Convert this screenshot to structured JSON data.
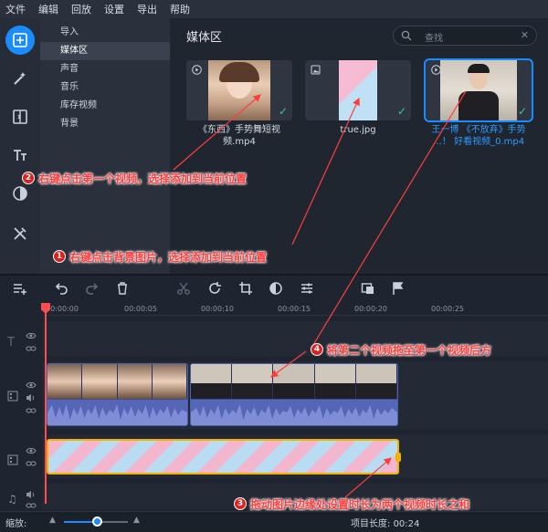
{
  "menu": [
    "文件",
    "编辑",
    "回放",
    "设置",
    "导出",
    "帮助"
  ],
  "nav": {
    "items": [
      "导入",
      "媒体区",
      "声音",
      "音乐",
      "库存视频",
      "背景"
    ],
    "active_index": 1
  },
  "media": {
    "title": "媒体区",
    "search_placeholder": "查找",
    "items": [
      {
        "caption_line1": "《东西》手势舞短视",
        "caption_line2": "频.mp4",
        "type": "video-icon",
        "added": true,
        "selected": false
      },
      {
        "caption_line1": "true.jpg",
        "caption_line2": "",
        "type": "image-icon",
        "added": true,
        "selected": false
      },
      {
        "caption_line1": "王一博 《不放弃》手势",
        "caption_line2": "…！ 好看视频_0.mp4",
        "type": "video-icon",
        "added": true,
        "selected": true
      }
    ]
  },
  "annotations": [
    {
      "num": "2",
      "text": "右键点击第一个视频，选择添加到当前位置"
    },
    {
      "num": "1",
      "text": "右键点击背景图片，选择添加到当前位置"
    },
    {
      "num": "4",
      "text": "将第二个视频拖至第一个视频后方"
    },
    {
      "num": "3",
      "text": "拖动图片边缘处设置时长为两个视频时长之和"
    }
  ],
  "timeline": {
    "ticks": [
      "00:00:00",
      "00:00:05",
      "00:00:10",
      "00:00:15",
      "00:00:20",
      "00:00:25"
    ],
    "playhead_time": "00:00:00"
  },
  "bottom": {
    "zoom_label": "缩放:",
    "project_length_label": "项目长度:",
    "project_length_value": "00:24"
  },
  "colors": {
    "accent": "#1a8cff",
    "annotation": "#ff3d3d",
    "image_clip_border": "#f0b400",
    "check": "#3fc48f"
  }
}
